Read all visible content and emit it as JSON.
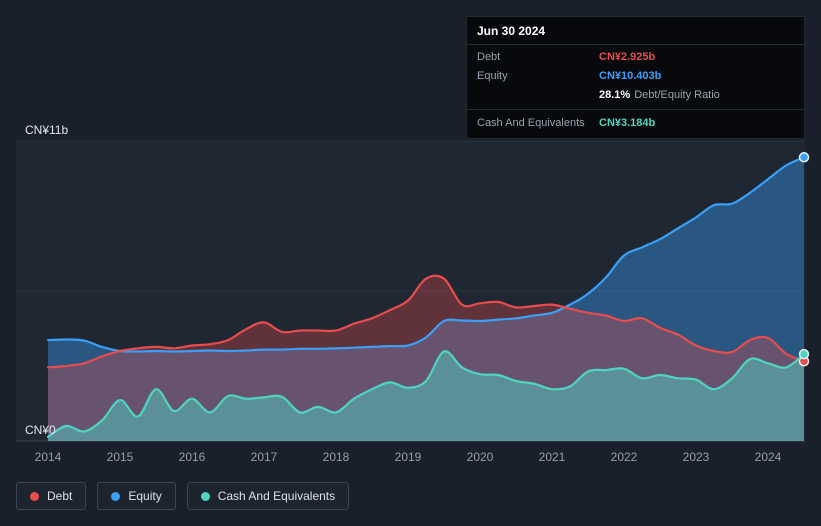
{
  "axis": {
    "y_top": "CN¥11b",
    "y_bottom": "CN¥0"
  },
  "tooltip": {
    "title": "Jun 30 2024",
    "debt_label": "Debt",
    "debt_value": "CN¥2.925b",
    "equity_label": "Equity",
    "equity_value": "CN¥10.403b",
    "ratio_value": "28.1%",
    "ratio_label": "Debt/Equity Ratio",
    "cash_label": "Cash And Equivalents",
    "cash_value": "CN¥3.184b"
  },
  "legend": {
    "debt": "Debt",
    "equity": "Equity",
    "cash": "Cash And Equivalents"
  },
  "chart_data": {
    "type": "area",
    "unit": "CN¥ billions",
    "ylim": [
      0,
      11
    ],
    "y_gridlines": [
      0,
      5.5,
      11
    ],
    "legend_position": "bottom-left",
    "x_ticks": [
      2014,
      2015,
      2016,
      2017,
      2018,
      2019,
      2020,
      2021,
      2022,
      2023,
      2024
    ],
    "x": [
      2014.0,
      2014.25,
      2014.5,
      2014.75,
      2015.0,
      2015.25,
      2015.5,
      2015.75,
      2016.0,
      2016.25,
      2016.5,
      2016.75,
      2017.0,
      2017.25,
      2017.5,
      2017.75,
      2018.0,
      2018.25,
      2018.5,
      2018.75,
      2019.0,
      2019.25,
      2019.5,
      2019.75,
      2020.0,
      2020.25,
      2020.5,
      2020.75,
      2021.0,
      2021.25,
      2021.5,
      2021.75,
      2022.0,
      2022.25,
      2022.5,
      2022.75,
      2023.0,
      2023.25,
      2023.5,
      2023.75,
      2024.0,
      2024.25,
      2024.5
    ],
    "series": [
      {
        "key": "debt",
        "name": "Debt",
        "color": "#e84c4c",
        "values": [
          2.7,
          2.75,
          2.85,
          3.1,
          3.3,
          3.4,
          3.45,
          3.4,
          3.5,
          3.55,
          3.7,
          4.1,
          4.35,
          4.0,
          4.05,
          4.05,
          4.05,
          4.3,
          4.5,
          4.8,
          5.15,
          5.95,
          5.95,
          5.0,
          5.05,
          5.1,
          4.9,
          4.95,
          5.0,
          4.85,
          4.7,
          4.6,
          4.4,
          4.5,
          4.15,
          3.9,
          3.5,
          3.3,
          3.26,
          3.7,
          3.78,
          3.2,
          2.925
        ]
      },
      {
        "key": "equity",
        "name": "Equity",
        "color": "#3b9ff7",
        "values": [
          3.7,
          3.72,
          3.68,
          3.45,
          3.3,
          3.28,
          3.3,
          3.28,
          3.3,
          3.32,
          3.3,
          3.32,
          3.35,
          3.35,
          3.38,
          3.38,
          3.4,
          3.42,
          3.45,
          3.48,
          3.5,
          3.8,
          4.4,
          4.42,
          4.4,
          4.45,
          4.5,
          4.6,
          4.7,
          5.0,
          5.4,
          6.0,
          6.8,
          7.1,
          7.4,
          7.8,
          8.2,
          8.65,
          8.7,
          9.1,
          9.6,
          10.1,
          10.403
        ]
      },
      {
        "key": "cash",
        "name": "Cash And Equivalents",
        "color": "#4fd4c2",
        "values": [
          0.15,
          0.55,
          0.35,
          0.75,
          1.5,
          0.9,
          1.9,
          1.1,
          1.55,
          1.05,
          1.65,
          1.55,
          1.6,
          1.62,
          1.05,
          1.25,
          1.05,
          1.55,
          1.9,
          2.15,
          1.95,
          2.2,
          3.28,
          2.7,
          2.45,
          2.42,
          2.2,
          2.1,
          1.9,
          2.0,
          2.55,
          2.6,
          2.65,
          2.3,
          2.42,
          2.3,
          2.25,
          1.9,
          2.3,
          3.0,
          2.85,
          2.7,
          3.184
        ]
      }
    ],
    "latest": {
      "date": "Jun 30 2024",
      "debt": 2.925,
      "equity": 10.403,
      "cash": 3.184,
      "debt_equity_ratio_pct": 28.1
    }
  }
}
